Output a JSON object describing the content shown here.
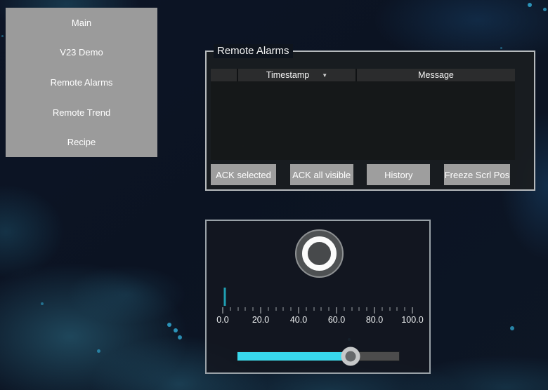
{
  "sidebar": {
    "items": [
      {
        "label": "Main"
      },
      {
        "label": "V23 Demo"
      },
      {
        "label": "Remote Alarms"
      },
      {
        "label": "Remote Trend"
      },
      {
        "label": "Recipe"
      }
    ]
  },
  "alarms": {
    "title": "Remote Alarms",
    "table": {
      "columns": [
        "",
        "Timestamp",
        "Message"
      ],
      "sorted_column": "Timestamp",
      "sort_icon": "▼",
      "rows": []
    },
    "buttons": [
      "ACK selected",
      "ACK all visible",
      "History",
      "Freeze Scrl Pos"
    ]
  },
  "control_panel": {
    "knob": {
      "style": "ring-indicator"
    },
    "gauge": {
      "type": "linear-scale",
      "min": 0,
      "max": 100,
      "value": 1,
      "major_tick_labels": [
        "0.0",
        "20.0",
        "40.0",
        "60.0",
        "80.0",
        "100.0"
      ],
      "minor_ticks_per_interval": 4
    },
    "slider": {
      "min": 0,
      "max": 100,
      "value": 70
    }
  },
  "colors": {
    "accent_cyan": "#38d8ec",
    "needle_teal": "#1f9fb2",
    "panel_gray": "#9b9b9b",
    "border_gray": "#b5b9bc",
    "header_dark": "#2b2c2d",
    "background_navy": "#0c1321"
  }
}
